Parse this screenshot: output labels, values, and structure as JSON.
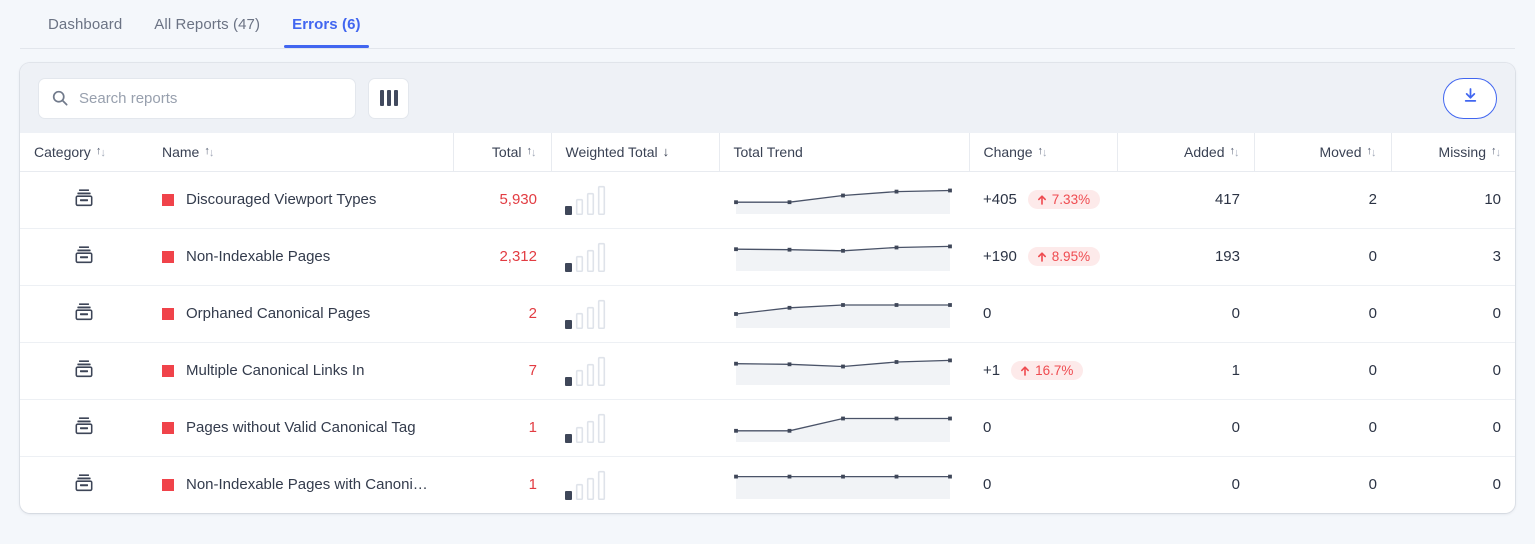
{
  "tabs": [
    {
      "label": "Dashboard",
      "active": false
    },
    {
      "label": "All Reports (47)",
      "active": false
    },
    {
      "label": "Errors (6)",
      "active": true
    }
  ],
  "toolbar": {
    "search_placeholder": "Search reports",
    "search_value": "",
    "search_icon": "search-icon",
    "columns_icon": "columns-icon",
    "download_icon": "download-icon"
  },
  "colors": {
    "accent": "#4166f0",
    "status_square": "#f0434a",
    "total_value": "#e23c42",
    "pill_bg": "#fdeaea",
    "pill_text": "#ef4b50",
    "toolbar_bg": "#eef1f6",
    "page_bg": "#f4f7fb"
  },
  "table": {
    "columns": [
      {
        "key": "category",
        "label": "Category",
        "sort": "both",
        "align": "left"
      },
      {
        "key": "name",
        "label": "Name",
        "sort": "both",
        "align": "left"
      },
      {
        "key": "total",
        "label": "Total",
        "sort": "both",
        "align": "right"
      },
      {
        "key": "weighted_total",
        "label": "Weighted Total",
        "sort": "desc",
        "align": "left"
      },
      {
        "key": "total_trend",
        "label": "Total Trend",
        "sort": "none",
        "align": "left"
      },
      {
        "key": "change",
        "label": "Change",
        "sort": "both",
        "align": "left"
      },
      {
        "key": "added",
        "label": "Added",
        "sort": "both",
        "align": "right"
      },
      {
        "key": "moved",
        "label": "Moved",
        "sort": "both",
        "align": "right"
      },
      {
        "key": "missing",
        "label": "Missing",
        "sort": "both",
        "align": "right"
      }
    ],
    "rows": [
      {
        "category_icon": "archive-icon",
        "name": "Discouraged Viewport Types",
        "total": "5,930",
        "weighted_bars": [
          30,
          52,
          74,
          96
        ],
        "weighted_filled": 1,
        "trend": [
          42,
          42,
          66,
          80,
          84
        ],
        "change": "+405",
        "pill": "7.33%",
        "pill_dir": "up",
        "added": "417",
        "moved": "2",
        "missing": "10"
      },
      {
        "category_icon": "archive-icon",
        "name": "Non-Indexable Pages",
        "total": "2,312",
        "weighted_bars": [
          30,
          52,
          74,
          96
        ],
        "weighted_filled": 1,
        "trend": [
          78,
          76,
          72,
          84,
          88
        ],
        "change": "+190",
        "pill": "8.95%",
        "pill_dir": "up",
        "added": "193",
        "moved": "0",
        "missing": "3"
      },
      {
        "category_icon": "archive-icon",
        "name": "Orphaned Canonical Pages",
        "total": "2",
        "weighted_bars": [
          30,
          52,
          74,
          96
        ],
        "weighted_filled": 1,
        "trend": [
          50,
          72,
          82,
          82,
          82
        ],
        "change": "0",
        "pill": "",
        "pill_dir": "",
        "added": "0",
        "moved": "0",
        "missing": "0"
      },
      {
        "category_icon": "archive-icon",
        "name": "Multiple Canonical Links In",
        "total": "7",
        "weighted_bars": [
          30,
          52,
          74,
          96
        ],
        "weighted_filled": 1,
        "trend": [
          76,
          74,
          66,
          82,
          88
        ],
        "change": "+1",
        "pill": "16.7%",
        "pill_dir": "up",
        "added": "1",
        "moved": "0",
        "missing": "0"
      },
      {
        "category_icon": "archive-icon",
        "name": "Pages without Valid Canonical Tag",
        "total": "1",
        "weighted_bars": [
          30,
          52,
          74,
          96
        ],
        "weighted_filled": 1,
        "trend": [
          40,
          40,
          84,
          84,
          84
        ],
        "change": "0",
        "pill": "",
        "pill_dir": "",
        "added": "0",
        "moved": "0",
        "missing": "0"
      },
      {
        "category_icon": "archive-icon",
        "name": "Non-Indexable Pages with Canoni…",
        "total": "1",
        "weighted_bars": [
          30,
          52,
          74,
          96
        ],
        "weighted_filled": 1,
        "trend": [
          80,
          80,
          80,
          80,
          80
        ],
        "change": "0",
        "pill": "",
        "pill_dir": "",
        "added": "0",
        "moved": "0",
        "missing": "0"
      }
    ]
  }
}
